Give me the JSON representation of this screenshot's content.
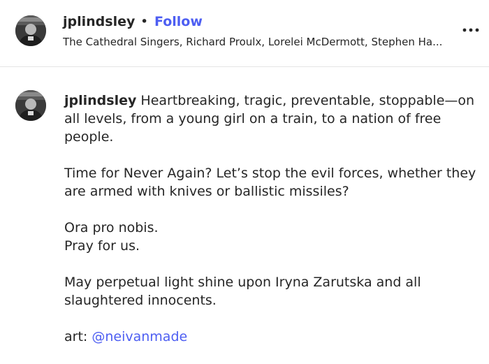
{
  "header": {
    "username": "jplindsley",
    "separator": "•",
    "follow_label": "Follow",
    "audio_text": "The Cathedral Singers, Richard Proulx, Lorelei McDermott, Stephen Ha...",
    "more_icon": "more-options-icon"
  },
  "post": {
    "username": "jplindsley",
    "paragraph_1": "Heartbreaking, tragic, preventable, stoppable—on all levels, from a young girl on a train, to a nation of free people.",
    "paragraph_2": "Time for Never Again? Let’s stop the evil forces, whether they are armed with knives or ballistic missiles?",
    "paragraph_3_line_1": "Ora pro nobis.",
    "paragraph_3_line_2": "Pray for us.",
    "paragraph_4": "May perpetual light shine upon Iryna Zarutska and all slaughtered innocents.",
    "art_label": "art:",
    "art_mention": "@neivanmade"
  },
  "colors": {
    "link": "#4d5ef2",
    "text": "#262626",
    "divider": "#e5e5e5"
  }
}
